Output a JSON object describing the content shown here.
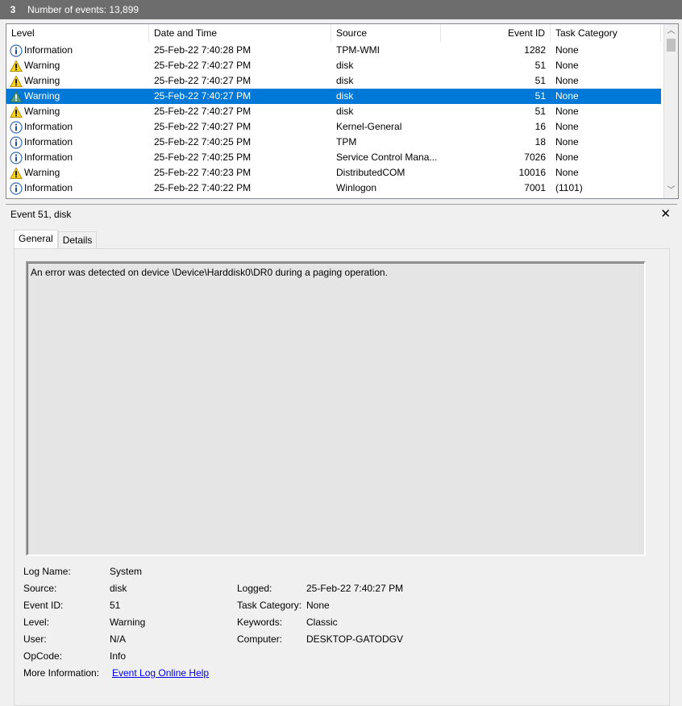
{
  "header": {
    "badge": "3",
    "event_count_label": "Number of events: 13,899"
  },
  "table": {
    "columns": [
      "Level",
      "Date and Time",
      "Source",
      "Event ID",
      "Task Category"
    ],
    "rows": [
      {
        "level": "Information",
        "date": "25-Feb-22 7:40:28 PM",
        "source": "TPM-WMI",
        "event_id": "1282",
        "category": "None"
      },
      {
        "level": "Warning",
        "date": "25-Feb-22 7:40:27 PM",
        "source": "disk",
        "event_id": "51",
        "category": "None"
      },
      {
        "level": "Warning",
        "date": "25-Feb-22 7:40:27 PM",
        "source": "disk",
        "event_id": "51",
        "category": "None"
      },
      {
        "level": "Warning",
        "date": "25-Feb-22 7:40:27 PM",
        "source": "disk",
        "event_id": "51",
        "category": "None",
        "selected": true
      },
      {
        "level": "Warning",
        "date": "25-Feb-22 7:40:27 PM",
        "source": "disk",
        "event_id": "51",
        "category": "None"
      },
      {
        "level": "Information",
        "date": "25-Feb-22 7:40:27 PM",
        "source": "Kernel-General",
        "event_id": "16",
        "category": "None"
      },
      {
        "level": "Information",
        "date": "25-Feb-22 7:40:25 PM",
        "source": "TPM",
        "event_id": "18",
        "category": "None"
      },
      {
        "level": "Information",
        "date": "25-Feb-22 7:40:25 PM",
        "source": "Service Control Mana...",
        "event_id": "7026",
        "category": "None"
      },
      {
        "level": "Warning",
        "date": "25-Feb-22 7:40:23 PM",
        "source": "DistributedCOM",
        "event_id": "10016",
        "category": "None"
      },
      {
        "level": "Information",
        "date": "25-Feb-22 7:40:22 PM",
        "source": "Winlogon",
        "event_id": "7001",
        "category": "(1101)"
      }
    ]
  },
  "detail": {
    "title": "Event 51, disk",
    "close_icon": "close-icon",
    "tabs": {
      "general": "General",
      "details": "Details"
    },
    "message": "An error was detected on device \\Device\\Harddisk0\\DR0 during a paging operation.",
    "props": {
      "log_name_label": "Log Name:",
      "log_name": "System",
      "source_label": "Source:",
      "source": "disk",
      "logged_label": "Logged:",
      "logged": "25-Feb-22 7:40:27 PM",
      "event_id_label": "Event ID:",
      "event_id": "51",
      "task_category_label": "Task Category:",
      "task_category": "None",
      "level_label": "Level:",
      "level": "Warning",
      "keywords_label": "Keywords:",
      "keywords": "Classic",
      "user_label": "User:",
      "user": "N/A",
      "computer_label": "Computer:",
      "computer": "DESKTOP-GATODGV",
      "opcode_label": "OpCode:",
      "opcode": "Info",
      "more_info_label": "More Information:",
      "more_info_link": "Event Log Online Help"
    }
  },
  "colors": {
    "selection": "#0078d7",
    "header_bar": "#6d6d6d",
    "link": "#0000ee"
  }
}
